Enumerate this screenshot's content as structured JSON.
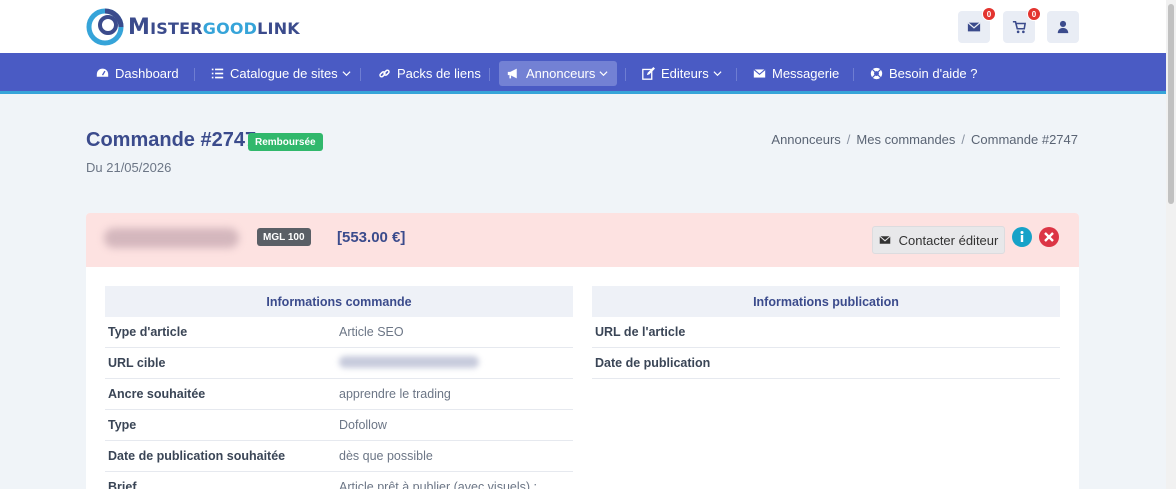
{
  "header": {
    "logo_text_big1": "M",
    "logo_text_part1": "ISTER",
    "logo_text_part2": "GOOD",
    "logo_text_part3": "LINK",
    "messages_count": "0",
    "cart_count": "0"
  },
  "nav": {
    "items": [
      {
        "label": "Dashboard",
        "icon": "dashboard-icon"
      },
      {
        "label": "Catalogue de sites",
        "icon": "list-icon"
      },
      {
        "label": "Packs de liens",
        "icon": "link-icon"
      },
      {
        "label": "Annonceurs",
        "icon": "megaphone-icon"
      },
      {
        "label": "Editeurs",
        "icon": "edit-icon"
      },
      {
        "label": "Messagerie",
        "icon": "envelope-icon"
      },
      {
        "label": "Besoin d'aide ?",
        "icon": "help-icon"
      }
    ]
  },
  "page": {
    "title": "Commande #2747",
    "status": "Remboursée",
    "date": "Du 21/05/2026",
    "status_color": "#31b86c"
  },
  "breadcrumb": [
    "Annonceurs",
    "Mes commandes",
    "Commande #2747"
  ],
  "order": {
    "tag": "MGL 100",
    "price": "[553.00 €]",
    "contact_label": "Contacter éditeur"
  },
  "commande": {
    "header": "Informations commande",
    "rows": [
      {
        "key": "Type d'article",
        "value": "Article SEO"
      },
      {
        "key": "URL cible",
        "value": ""
      },
      {
        "key": "Ancre souhaitée",
        "value": "apprendre le trading"
      },
      {
        "key": "Type",
        "value": "Dofollow"
      },
      {
        "key": "Date de publication souhaitée",
        "value": "dès que possible"
      },
      {
        "key": "Brief",
        "value": "Article prêt à publier (avec visuels) :"
      }
    ]
  },
  "publication": {
    "header": "Informations publication",
    "rows": [
      {
        "key": "URL de l'article",
        "value": ""
      },
      {
        "key": "Date de publication",
        "value": ""
      }
    ]
  }
}
